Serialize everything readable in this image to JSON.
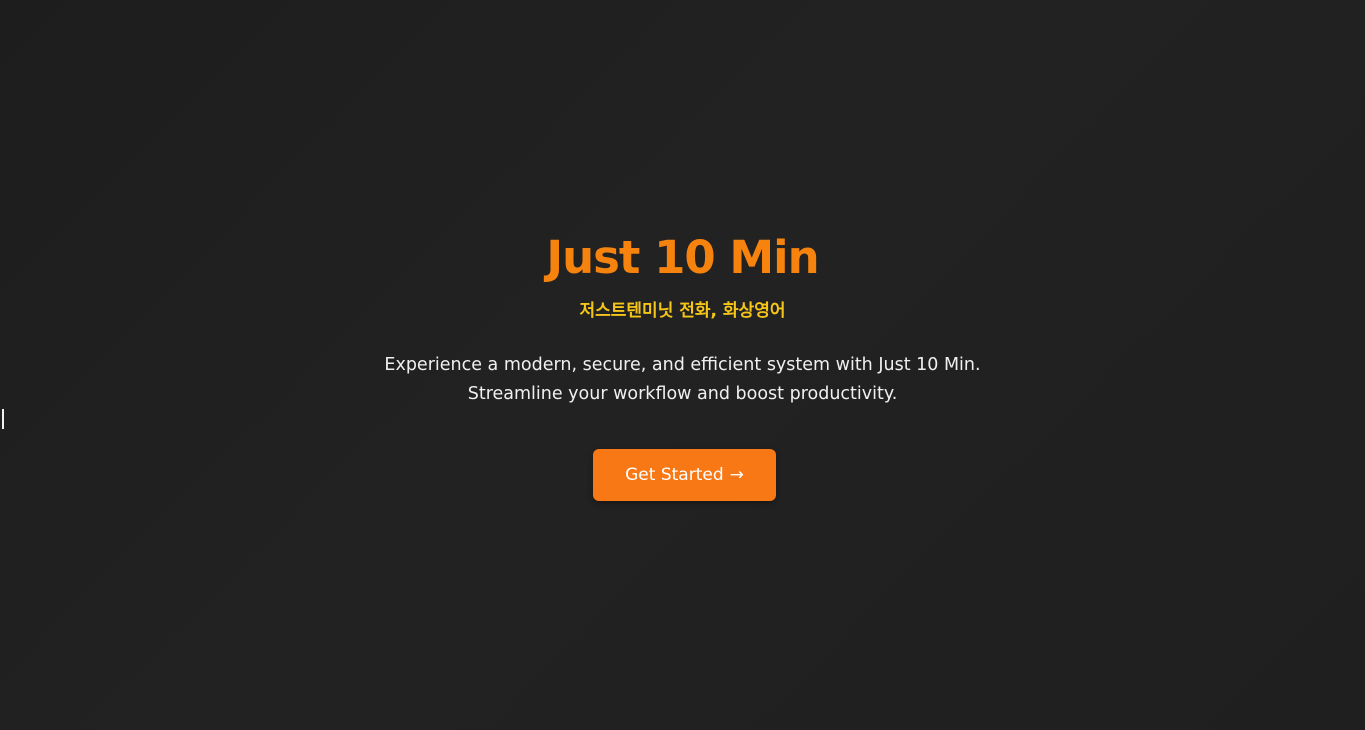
{
  "hero": {
    "title": "Just 10 Min",
    "subtitle": "저스트텐미닛 전화, 화상영어",
    "description_line1": "Experience a modern, secure, and efficient system with Just 10 Min.",
    "description_line2": "Streamline your workflow and boost productivity.",
    "cta_label": "Get Started",
    "cta_arrow": "→"
  },
  "colors": {
    "background": "#1f1f1f",
    "title": "#f7830f",
    "subtitle": "#f5c518",
    "text": "#f0f0f0",
    "button": "#f97816"
  },
  "icons": {
    "cta_arrow": "right-arrow-icon"
  }
}
